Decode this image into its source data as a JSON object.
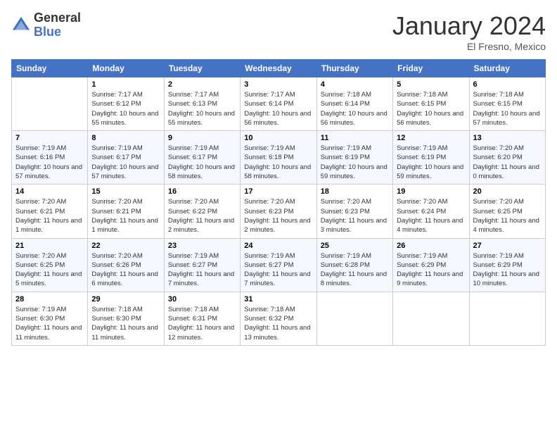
{
  "header": {
    "logo_general": "General",
    "logo_blue": "Blue",
    "month_year": "January 2024",
    "location": "El Fresno, Mexico"
  },
  "days_of_week": [
    "Sunday",
    "Monday",
    "Tuesday",
    "Wednesday",
    "Thursday",
    "Friday",
    "Saturday"
  ],
  "weeks": [
    [
      {
        "day": "",
        "sunrise": "",
        "sunset": "",
        "daylight": ""
      },
      {
        "day": "1",
        "sunrise": "Sunrise: 7:17 AM",
        "sunset": "Sunset: 6:12 PM",
        "daylight": "Daylight: 10 hours and 55 minutes."
      },
      {
        "day": "2",
        "sunrise": "Sunrise: 7:17 AM",
        "sunset": "Sunset: 6:13 PM",
        "daylight": "Daylight: 10 hours and 55 minutes."
      },
      {
        "day": "3",
        "sunrise": "Sunrise: 7:17 AM",
        "sunset": "Sunset: 6:14 PM",
        "daylight": "Daylight: 10 hours and 56 minutes."
      },
      {
        "day": "4",
        "sunrise": "Sunrise: 7:18 AM",
        "sunset": "Sunset: 6:14 PM",
        "daylight": "Daylight: 10 hours and 56 minutes."
      },
      {
        "day": "5",
        "sunrise": "Sunrise: 7:18 AM",
        "sunset": "Sunset: 6:15 PM",
        "daylight": "Daylight: 10 hours and 56 minutes."
      },
      {
        "day": "6",
        "sunrise": "Sunrise: 7:18 AM",
        "sunset": "Sunset: 6:15 PM",
        "daylight": "Daylight: 10 hours and 57 minutes."
      }
    ],
    [
      {
        "day": "7",
        "sunrise": "Sunrise: 7:19 AM",
        "sunset": "Sunset: 6:16 PM",
        "daylight": "Daylight: 10 hours and 57 minutes."
      },
      {
        "day": "8",
        "sunrise": "Sunrise: 7:19 AM",
        "sunset": "Sunset: 6:17 PM",
        "daylight": "Daylight: 10 hours and 57 minutes."
      },
      {
        "day": "9",
        "sunrise": "Sunrise: 7:19 AM",
        "sunset": "Sunset: 6:17 PM",
        "daylight": "Daylight: 10 hours and 58 minutes."
      },
      {
        "day": "10",
        "sunrise": "Sunrise: 7:19 AM",
        "sunset": "Sunset: 6:18 PM",
        "daylight": "Daylight: 10 hours and 58 minutes."
      },
      {
        "day": "11",
        "sunrise": "Sunrise: 7:19 AM",
        "sunset": "Sunset: 6:19 PM",
        "daylight": "Daylight: 10 hours and 59 minutes."
      },
      {
        "day": "12",
        "sunrise": "Sunrise: 7:19 AM",
        "sunset": "Sunset: 6:19 PM",
        "daylight": "Daylight: 10 hours and 59 minutes."
      },
      {
        "day": "13",
        "sunrise": "Sunrise: 7:20 AM",
        "sunset": "Sunset: 6:20 PM",
        "daylight": "Daylight: 11 hours and 0 minutes."
      }
    ],
    [
      {
        "day": "14",
        "sunrise": "Sunrise: 7:20 AM",
        "sunset": "Sunset: 6:21 PM",
        "daylight": "Daylight: 11 hours and 1 minute."
      },
      {
        "day": "15",
        "sunrise": "Sunrise: 7:20 AM",
        "sunset": "Sunset: 6:21 PM",
        "daylight": "Daylight: 11 hours and 1 minute."
      },
      {
        "day": "16",
        "sunrise": "Sunrise: 7:20 AM",
        "sunset": "Sunset: 6:22 PM",
        "daylight": "Daylight: 11 hours and 2 minutes."
      },
      {
        "day": "17",
        "sunrise": "Sunrise: 7:20 AM",
        "sunset": "Sunset: 6:23 PM",
        "daylight": "Daylight: 11 hours and 2 minutes."
      },
      {
        "day": "18",
        "sunrise": "Sunrise: 7:20 AM",
        "sunset": "Sunset: 6:23 PM",
        "daylight": "Daylight: 11 hours and 3 minutes."
      },
      {
        "day": "19",
        "sunrise": "Sunrise: 7:20 AM",
        "sunset": "Sunset: 6:24 PM",
        "daylight": "Daylight: 11 hours and 4 minutes."
      },
      {
        "day": "20",
        "sunrise": "Sunrise: 7:20 AM",
        "sunset": "Sunset: 6:25 PM",
        "daylight": "Daylight: 11 hours and 4 minutes."
      }
    ],
    [
      {
        "day": "21",
        "sunrise": "Sunrise: 7:20 AM",
        "sunset": "Sunset: 6:25 PM",
        "daylight": "Daylight: 11 hours and 5 minutes."
      },
      {
        "day": "22",
        "sunrise": "Sunrise: 7:20 AM",
        "sunset": "Sunset: 6:26 PM",
        "daylight": "Daylight: 11 hours and 6 minutes."
      },
      {
        "day": "23",
        "sunrise": "Sunrise: 7:19 AM",
        "sunset": "Sunset: 6:27 PM",
        "daylight": "Daylight: 11 hours and 7 minutes."
      },
      {
        "day": "24",
        "sunrise": "Sunrise: 7:19 AM",
        "sunset": "Sunset: 6:27 PM",
        "daylight": "Daylight: 11 hours and 7 minutes."
      },
      {
        "day": "25",
        "sunrise": "Sunrise: 7:19 AM",
        "sunset": "Sunset: 6:28 PM",
        "daylight": "Daylight: 11 hours and 8 minutes."
      },
      {
        "day": "26",
        "sunrise": "Sunrise: 7:19 AM",
        "sunset": "Sunset: 6:29 PM",
        "daylight": "Daylight: 11 hours and 9 minutes."
      },
      {
        "day": "27",
        "sunrise": "Sunrise: 7:19 AM",
        "sunset": "Sunset: 6:29 PM",
        "daylight": "Daylight: 11 hours and 10 minutes."
      }
    ],
    [
      {
        "day": "28",
        "sunrise": "Sunrise: 7:19 AM",
        "sunset": "Sunset: 6:30 PM",
        "daylight": "Daylight: 11 hours and 11 minutes."
      },
      {
        "day": "29",
        "sunrise": "Sunrise: 7:18 AM",
        "sunset": "Sunset: 6:30 PM",
        "daylight": "Daylight: 11 hours and 11 minutes."
      },
      {
        "day": "30",
        "sunrise": "Sunrise: 7:18 AM",
        "sunset": "Sunset: 6:31 PM",
        "daylight": "Daylight: 11 hours and 12 minutes."
      },
      {
        "day": "31",
        "sunrise": "Sunrise: 7:18 AM",
        "sunset": "Sunset: 6:32 PM",
        "daylight": "Daylight: 11 hours and 13 minutes."
      },
      {
        "day": "",
        "sunrise": "",
        "sunset": "",
        "daylight": ""
      },
      {
        "day": "",
        "sunrise": "",
        "sunset": "",
        "daylight": ""
      },
      {
        "day": "",
        "sunrise": "",
        "sunset": "",
        "daylight": ""
      }
    ]
  ]
}
